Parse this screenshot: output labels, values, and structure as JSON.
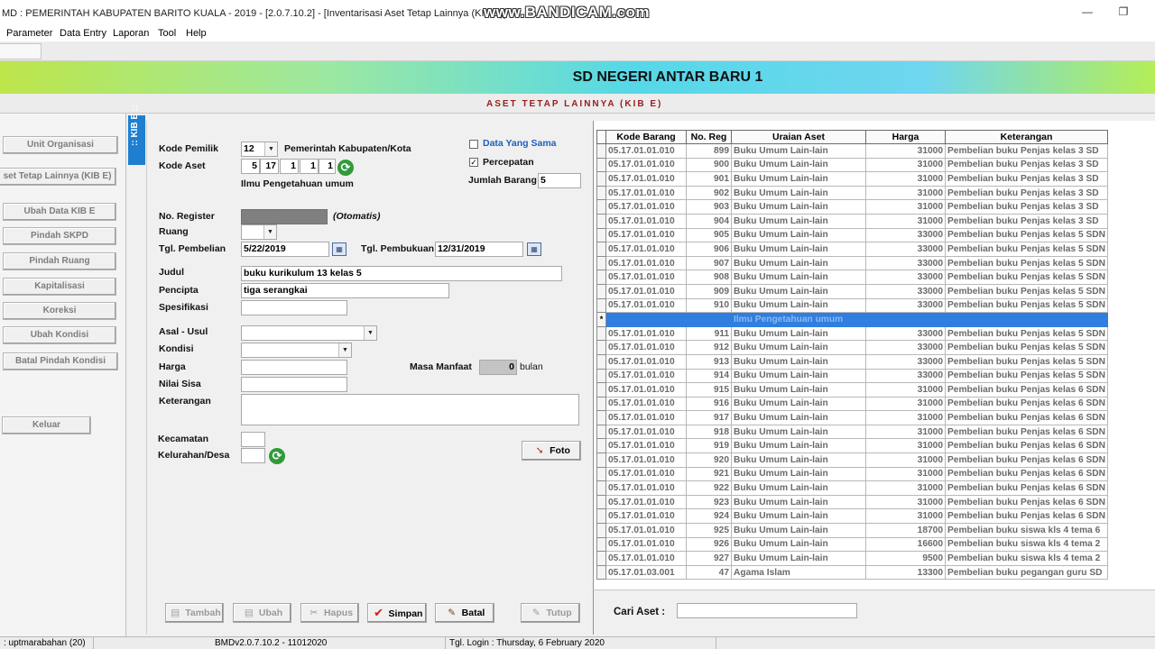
{
  "window": {
    "title": "MD : PEMERINTAH KABUPATEN BARITO KUALA - 2019 - [2.0.7.10.2] - [Inventarisasi Aset Tetap Lainnya (KIB E)]",
    "watermark": "www.BANDICAM.com",
    "minimize": "—",
    "maximize": "❐"
  },
  "menu": [
    "Parameter",
    "Data Entry",
    "Laporan",
    "Tool",
    "Help"
  ],
  "banner": {
    "school": "SD NEGERI ANTAR BARU 1",
    "subtitle": "ASET TETAP LAINNYA (KIB E)"
  },
  "sidebar": {
    "tab": ":: KIB E ::",
    "buttons": [
      "Unit Organisasi",
      "set Tetap Lainnya (KIB E)",
      "Ubah Data KIB E",
      "Pindah SKPD",
      "Pindah Ruang",
      "Kapitalisasi",
      "Koreksi",
      "Ubah Kondisi",
      "Batal Pindah Kondisi",
      "Keluar"
    ]
  },
  "form": {
    "kode_pemilik_label": "Kode Pemilik",
    "kode_pemilik_value": "12",
    "kode_pemilik_desc": "Pemerintah Kabupaten/Kota",
    "kode_aset_label": "Kode Aset",
    "kode_aset_parts": [
      "5",
      "17",
      "1",
      "1",
      "1"
    ],
    "kode_aset_desc": "Ilmu Pengetahuan umum",
    "data_yang_sama_label": "Data Yang Sama",
    "percepatan_label": "Percepatan",
    "percepatan_check": "✓",
    "jumlah_barang_label": "Jumlah Barang",
    "jumlah_barang_value": "5",
    "no_register_label": "No. Register",
    "no_register_note": "(Otomatis)",
    "ruang_label": "Ruang",
    "tgl_pembelian_label": "Tgl. Pembelian",
    "tgl_pembelian_value": "5/22/2019",
    "tgl_pembukuan_label": "Tgl. Pembukuan",
    "tgl_pembukuan_value": "12/31/2019",
    "judul_label": "Judul",
    "judul_value": "buku kurikulum 13 kelas 5",
    "pencipta_label": "Pencipta",
    "pencipta_value": "tiga serangkai",
    "spesifikasi_label": "Spesifikasi",
    "asal_usul_label": "Asal - Usul",
    "kondisi_label": "Kondisi",
    "harga_label": "Harga",
    "masa_manfaat_label": "Masa Manfaat",
    "masa_manfaat_value": "0",
    "bulan_label": "bulan",
    "nilai_sisa_label": "Nilai Sisa",
    "keterangan_label": "Keterangan",
    "kecamatan_label": "Kecamatan",
    "kelurahan_label": "Kelurahan/Desa",
    "foto_label": "Foto"
  },
  "actions": {
    "tambah": "Tambah",
    "ubah": "Ubah",
    "hapus": "Hapus",
    "simpan": "Simpan",
    "batal": "Batal",
    "tutup": "Tutup"
  },
  "grid": {
    "columns": [
      "Kode Barang",
      "No. Reg",
      "Uraian Aset",
      "Harga",
      "Keterangan"
    ],
    "rows": [
      [
        "05.17.01.01.010",
        "899",
        "Buku Umum Lain-lain",
        "31000",
        "Pembelian buku Penjas  kelas  3 SD"
      ],
      [
        "05.17.01.01.010",
        "900",
        "Buku Umum Lain-lain",
        "31000",
        "Pembelian buku Penjas  kelas  3 SD"
      ],
      [
        "05.17.01.01.010",
        "901",
        "Buku Umum Lain-lain",
        "31000",
        "Pembelian buku Penjas  kelas  3 SD"
      ],
      [
        "05.17.01.01.010",
        "902",
        "Buku Umum Lain-lain",
        "31000",
        "Pembelian buku Penjas  kelas  3 SD"
      ],
      [
        "05.17.01.01.010",
        "903",
        "Buku Umum Lain-lain",
        "31000",
        "Pembelian buku Penjas  kelas  3 SD"
      ],
      [
        "05.17.01.01.010",
        "904",
        "Buku Umum Lain-lain",
        "31000",
        "Pembelian buku Penjas  kelas  3 SD"
      ],
      [
        "05.17.01.01.010",
        "905",
        "Buku Umum Lain-lain",
        "33000",
        "Pembelian buku Penjas kelas 5 SDN"
      ],
      [
        "05.17.01.01.010",
        "906",
        "Buku Umum Lain-lain",
        "33000",
        "Pembelian buku Penjas kelas 5 SDN"
      ],
      [
        "05.17.01.01.010",
        "907",
        "Buku Umum Lain-lain",
        "33000",
        "Pembelian buku Penjas kelas 5 SDN"
      ],
      [
        "05.17.01.01.010",
        "908",
        "Buku Umum Lain-lain",
        "33000",
        "Pembelian buku Penjas kelas 5 SDN"
      ],
      [
        "05.17.01.01.010",
        "909",
        "Buku Umum Lain-lain",
        "33000",
        "Pembelian buku Penjas kelas 5 SDN"
      ],
      [
        "05.17.01.01.010",
        "910",
        "Buku Umum Lain-lain",
        "33000",
        "Pembelian buku Penjas kelas 5 SDN"
      ],
      [
        "",
        "",
        "Ilmu Pengetahuan umum",
        "",
        ""
      ],
      [
        "05.17.01.01.010",
        "911",
        "Buku Umum Lain-lain",
        "33000",
        "Pembelian buku Penjas kelas 5 SDN"
      ],
      [
        "05.17.01.01.010",
        "912",
        "Buku Umum Lain-lain",
        "33000",
        "Pembelian buku Penjas kelas 5 SDN"
      ],
      [
        "05.17.01.01.010",
        "913",
        "Buku Umum Lain-lain",
        "33000",
        "Pembelian buku Penjas kelas 5 SDN"
      ],
      [
        "05.17.01.01.010",
        "914",
        "Buku Umum Lain-lain",
        "33000",
        "Pembelian buku Penjas kelas 5 SDN"
      ],
      [
        "05.17.01.01.010",
        "915",
        "Buku Umum Lain-lain",
        "31000",
        "Pembelian buku Penjas kelas 6 SDN"
      ],
      [
        "05.17.01.01.010",
        "916",
        "Buku Umum Lain-lain",
        "31000",
        "Pembelian buku Penjas kelas 6 SDN"
      ],
      [
        "05.17.01.01.010",
        "917",
        "Buku Umum Lain-lain",
        "31000",
        "Pembelian buku Penjas kelas 6 SDN"
      ],
      [
        "05.17.01.01.010",
        "918",
        "Buku Umum Lain-lain",
        "31000",
        "Pembelian buku Penjas kelas 6 SDN"
      ],
      [
        "05.17.01.01.010",
        "919",
        "Buku Umum Lain-lain",
        "31000",
        "Pembelian buku Penjas kelas 6 SDN"
      ],
      [
        "05.17.01.01.010",
        "920",
        "Buku Umum Lain-lain",
        "31000",
        "Pembelian buku Penjas kelas 6 SDN"
      ],
      [
        "05.17.01.01.010",
        "921",
        "Buku Umum Lain-lain",
        "31000",
        "Pembelian buku Penjas kelas 6 SDN"
      ],
      [
        "05.17.01.01.010",
        "922",
        "Buku Umum Lain-lain",
        "31000",
        "Pembelian buku Penjas kelas 6 SDN"
      ],
      [
        "05.17.01.01.010",
        "923",
        "Buku Umum Lain-lain",
        "31000",
        "Pembelian buku Penjas kelas 6 SDN"
      ],
      [
        "05.17.01.01.010",
        "924",
        "Buku Umum Lain-lain",
        "31000",
        "Pembelian buku Penjas kelas 6 SDN"
      ],
      [
        "05.17.01.01.010",
        "925",
        "Buku Umum Lain-lain",
        "18700",
        "Pembelian buku siswa kls 4 tema 6"
      ],
      [
        "05.17.01.01.010",
        "926",
        "Buku Umum Lain-lain",
        "16600",
        "Pembelian buku siswa kls 4 tema 2"
      ],
      [
        "05.17.01.01.010",
        "927",
        "Buku Umum Lain-lain",
        "9500",
        "Pembelian buku siswa kls 4 tema 2"
      ],
      [
        "05.17.01.03.001",
        "47",
        "Agama Islam",
        "13300",
        "Pembelian buku pegangan guru SD"
      ]
    ],
    "selected_row": 12,
    "new_row_marker": "*"
  },
  "search": {
    "label": "Cari Aset :",
    "value": ""
  },
  "status": {
    "user": ": uptmarabahan (20)",
    "version": "BMDv2.0.7.10.2 - 11012020",
    "login": "Tgl. Login :  Thursday,  6 February 2020"
  }
}
